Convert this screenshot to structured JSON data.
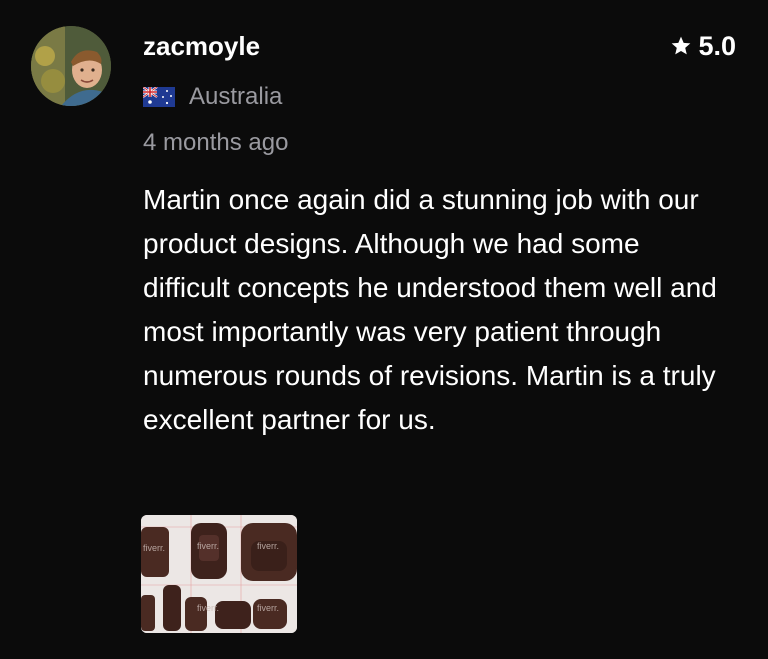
{
  "review": {
    "username": "zacmoyle",
    "rating": "5.0",
    "rating_icon": "star-icon",
    "country": "Australia",
    "flag_icon": "australia-flag-icon",
    "time_ago": "4 months ago",
    "text": "Martin once again did a stunning job with our product designs. Although we had some difficult concepts he understood them well and most importantly was very patient through numerous rounds of revisions. Martin is a truly excellent partner for us.",
    "attachment": {
      "watermark": "fiverr."
    }
  },
  "colors": {
    "background": "#0b0b0b",
    "primary_text": "#ffffff",
    "secondary_text": "#9a9aa0"
  }
}
